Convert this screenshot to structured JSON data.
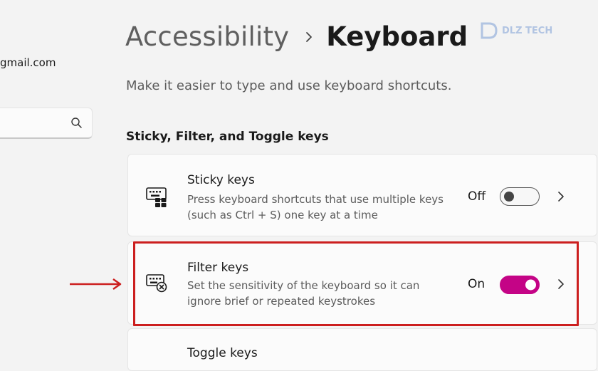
{
  "sidebar": {
    "account_email": "gmail.com",
    "search_value": ""
  },
  "header": {
    "breadcrumb_parent": "Accessibility",
    "breadcrumb_current": "Keyboard",
    "subtitle": "Make it easier to type and use keyboard shortcuts."
  },
  "watermark": {
    "text": "DLZ TECH"
  },
  "section": {
    "heading": "Sticky, Filter, and Toggle keys"
  },
  "settings": [
    {
      "title": "Sticky keys",
      "description": "Press keyboard shortcuts that use multiple keys (such as Ctrl + S) one key at a time",
      "state_label": "Off",
      "enabled": false,
      "icon": "sticky-keys-icon"
    },
    {
      "title": "Filter keys",
      "description": "Set the sensitivity of the keyboard so it can ignore brief or repeated keystrokes",
      "state_label": "On",
      "enabled": true,
      "icon": "filter-keys-icon"
    },
    {
      "title": "Toggle keys"
    }
  ],
  "colors": {
    "accent": "#c40486",
    "annotation": "#cc1f1f",
    "background": "#f3f3f3",
    "card": "#fbfbfb"
  },
  "annotation": {
    "highlighted_item": "Filter keys"
  }
}
